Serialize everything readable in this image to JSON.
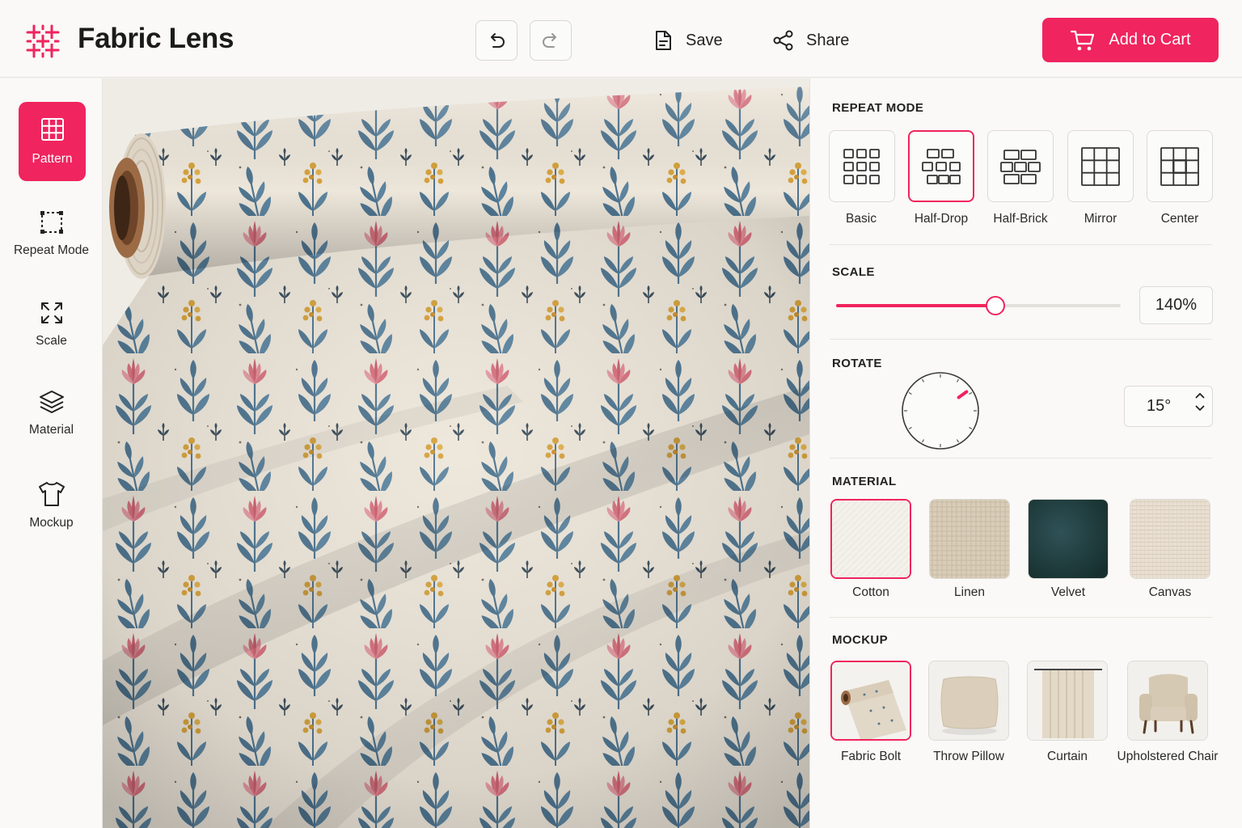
{
  "app": {
    "title": "Fabric Lens"
  },
  "toolbar": {
    "save_label": "Save",
    "share_label": "Share",
    "cart_label": "Add to Cart"
  },
  "sidebar": {
    "items": [
      {
        "label": "Pattern",
        "active": true
      },
      {
        "label": "Repeat Mode"
      },
      {
        "label": "Scale"
      },
      {
        "label": "Material"
      },
      {
        "label": "Mockup"
      }
    ]
  },
  "panel": {
    "repeat_mode": {
      "title": "REPEAT MODE",
      "options": [
        {
          "label": "Basic"
        },
        {
          "label": "Half-Drop",
          "selected": true
        },
        {
          "label": "Half-Brick"
        },
        {
          "label": "Mirror"
        },
        {
          "label": "Center"
        }
      ]
    },
    "scale": {
      "title": "SCALE",
      "value": "140%",
      "slider_fraction": 0.56
    },
    "rotate": {
      "title": "ROTATE",
      "value": "15°",
      "degrees": 15
    },
    "material": {
      "title": "MATERIAL",
      "options": [
        {
          "label": "Cotton",
          "selected": true
        },
        {
          "label": "Linen"
        },
        {
          "label": "Velvet"
        },
        {
          "label": "Canvas"
        }
      ]
    },
    "mockup": {
      "title": "MOCKUP",
      "options": [
        {
          "label": "Fabric Bolt",
          "selected": true
        },
        {
          "label": "Throw Pillow"
        },
        {
          "label": "Curtain"
        },
        {
          "label": "Upholstered Chair"
        }
      ]
    }
  },
  "colors": {
    "accent": "#f0245e",
    "fabric_base": "#ede6da",
    "leaf_blue": "#4f7590",
    "flower_pink": "#d7727f",
    "berry_gold": "#d6a23c"
  }
}
